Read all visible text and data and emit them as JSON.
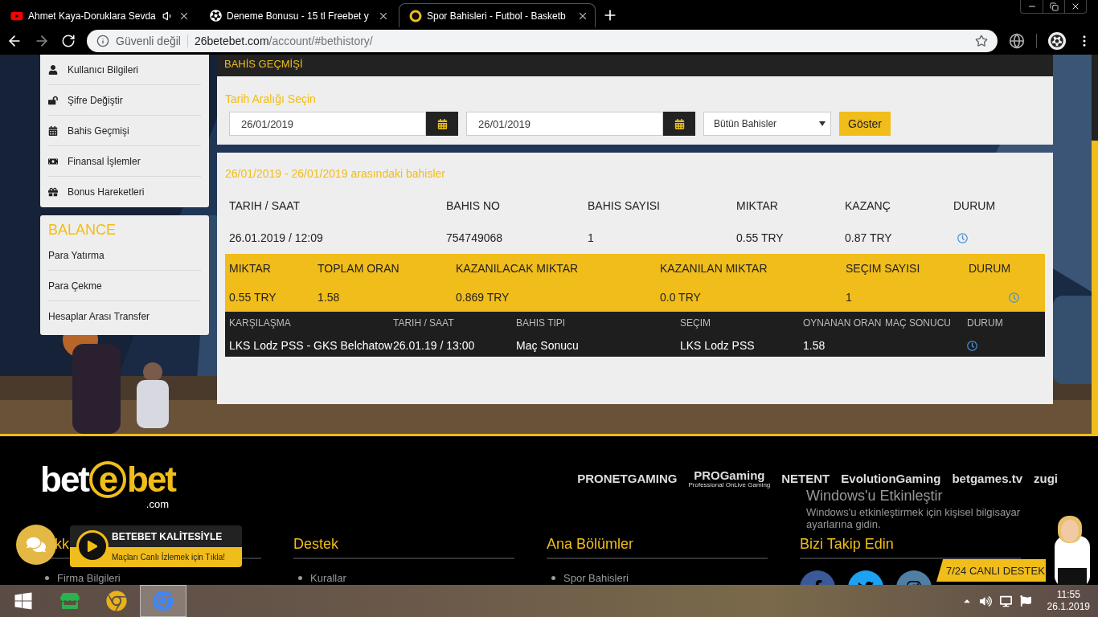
{
  "browser": {
    "tabs": [
      {
        "title": "Ahmet Kaya-Doruklara Sevda",
        "audio": true,
        "selected": false
      },
      {
        "title": "Deneme Bonusu - 15 tl Freebet y",
        "audio": false,
        "selected": false
      },
      {
        "title": "Spor Bahisleri - Futbol - Basketb",
        "audio": false,
        "selected": true
      }
    ],
    "address": {
      "security": "Güvenli değil",
      "host": "26betebet.com",
      "path": "/account/#bethistory/"
    }
  },
  "sidebar": {
    "menu": [
      {
        "label": "Kullanıcı Bilgileri"
      },
      {
        "label": "Şifre Değiştir"
      },
      {
        "label": "Bahis Geçmişi"
      },
      {
        "label": "Finansal İşlemler"
      },
      {
        "label": "Bonus Hareketleri"
      }
    ],
    "balance": {
      "title": "BALANCE",
      "items": [
        "Para Yatırma",
        "Para Çekme",
        "Hesaplar Arası Transfer"
      ]
    }
  },
  "page_header": "BAHİS GEÇMİŞİ",
  "filter": {
    "label": "Tarih Aralığı Seçin",
    "start": "26/01/2019",
    "end": "26/01/2019",
    "bet_type": "Bütün Bahisler",
    "button": "Göster"
  },
  "results": {
    "title": "26/01/2019 - 26/01/2019 arasındaki bahisler",
    "tables": [
      {
        "kind": "summary",
        "columns": [
          "TARIH / SAAT",
          "BAHIS NO",
          "BAHIS SAYISI",
          "MIKTAR",
          "KAZANÇ",
          "DURUM"
        ],
        "values": [
          "26.01.2019 / 12:09",
          "754749068",
          "1",
          "0.55 TRY",
          "0.87 TRY"
        ]
      },
      {
        "kind": "totals",
        "columns": [
          "MIKTAR",
          "TOPLAM ORAN",
          "KAZANILACAK MIKTAR",
          "KAZANILAN MIKTAR",
          "SEÇIM SAYISI",
          "DURUM"
        ],
        "values": [
          "0.55 TRY",
          "1.58",
          "0.869 TRY",
          "0.0 TRY",
          "1"
        ]
      },
      {
        "kind": "selections",
        "columns": [
          "KARŞILAŞMA",
          "TARIH / SAAT",
          "BAHIS TIPI",
          "SEÇIM",
          "OYNANAN ORAN",
          "MAÇ SONUCU",
          "DURUM"
        ],
        "values": [
          "LKS Lodz PSS - GKS Belchatow",
          "26.01.19 / 13:00",
          "Maç Sonucu",
          "LKS Lodz PSS",
          "1.58"
        ]
      }
    ]
  },
  "footer": {
    "logo": {
      "left": "bet",
      "mark": "e",
      "right": "bet",
      "domain": ".com"
    },
    "partners": [
      {
        "name": "PRONETGAMING"
      },
      {
        "name": "PROGaming",
        "sub": "Professional OnLive Gaming"
      },
      {
        "name": "NETENT"
      },
      {
        "name": "EvolutionGaming"
      },
      {
        "name": "betgames.tv"
      },
      {
        "name": "zugi"
      }
    ],
    "columns": [
      {
        "kind": "links",
        "title": "kk",
        "items": [
          "Firma Bilgileri"
        ]
      },
      {
        "kind": "links",
        "title": "Destek",
        "items": [
          "Kurallar"
        ]
      },
      {
        "kind": "links",
        "title": "Ana Bölümler",
        "items": [
          "Spor Bahisleri"
        ]
      },
      {
        "kind": "social",
        "title": "Bizi Takip Edin"
      }
    ],
    "promo": {
      "title": "BETEBET KALİTESİYLE",
      "subtitle": "Maçları Canlı İzlemek için Tıkla!"
    },
    "support": "7/24 CANLI DESTEK"
  },
  "activation": {
    "title": "Windows'u Etkinleştir",
    "lines": [
      "Windows'u etkinleştirmek için kişisel bilgisayar",
      "ayarlarına gidin."
    ]
  },
  "taskbar": {
    "apps": [
      {
        "selected": false
      },
      {
        "selected": false
      },
      {
        "selected": true
      }
    ],
    "time": "11:55",
    "date": "26.1.2019"
  }
}
